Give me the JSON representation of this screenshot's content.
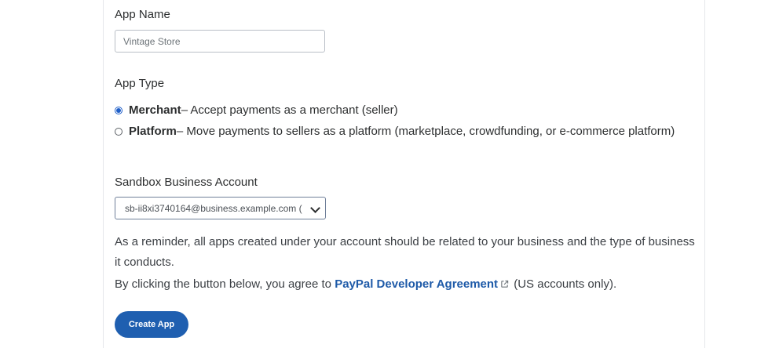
{
  "app_name": {
    "label": "App Name",
    "value": "Vintage Store"
  },
  "app_type": {
    "label": "App Type",
    "options": [
      {
        "title": "Merchant",
        "description": " – Accept payments as a merchant (seller)",
        "selected": true
      },
      {
        "title": "Platform",
        "description": " – Move payments to sellers as a platform (marketplace, crowdfunding, or e-commerce platform)",
        "selected": false
      }
    ]
  },
  "sandbox_account": {
    "label": "Sandbox Business Account",
    "selected_value": "sb-ii8xi3740164@business.example.com ("
  },
  "reminder": {
    "line1": "As a reminder, all apps created under your account should be related to your business and the type of business it conducts.",
    "agree_prefix": "By clicking the button below, you agree to ",
    "agreement_link": "PayPal Developer Agreement",
    "agree_suffix": " (US accounts only)."
  },
  "create_button": {
    "label": "Create App"
  },
  "colors": {
    "link": "#1e5aa8",
    "button": "#1f5fb0",
    "radio_selected": "#1e5ec8"
  },
  "icons": [
    "external-link-icon",
    "chevron-down-icon"
  ]
}
